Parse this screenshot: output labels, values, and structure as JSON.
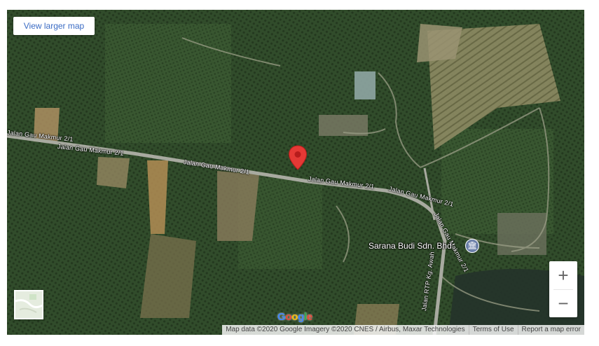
{
  "controls": {
    "view_larger_map": "View larger map",
    "zoom_in": "+",
    "zoom_out": "−"
  },
  "roads": {
    "label_1": "Jalan Gau Makmur 2/1",
    "label_2": "Jalan Gau Makmur 2/1",
    "label_3": "Jalan Gau Makmur 2/1",
    "label_4": "Jalan Gau Makmur 2/1",
    "label_5": "Jalan Gau Makmur 2/1",
    "label_6": "Jalan Gau Makmur 2/1",
    "label_7": "Jalan RTP Kg. Awah"
  },
  "poi": {
    "name": "Sarana Budi Sdn. Bhd",
    "icon": "museum-icon"
  },
  "marker": {
    "icon": "map-pin-icon",
    "color": "#e53935"
  },
  "branding": {
    "logo_letters": [
      "G",
      "o",
      "o",
      "g",
      "l",
      "e"
    ],
    "logo_colors": [
      "#4285f4",
      "#ea4335",
      "#fbbc05",
      "#4285f4",
      "#34a853",
      "#ea4335"
    ]
  },
  "attribution": {
    "map_data": "Map data ©2020 Google Imagery ©2020 CNES / Airbus, Maxar Technologies",
    "terms": "Terms of Use",
    "report": "Report a map error"
  }
}
